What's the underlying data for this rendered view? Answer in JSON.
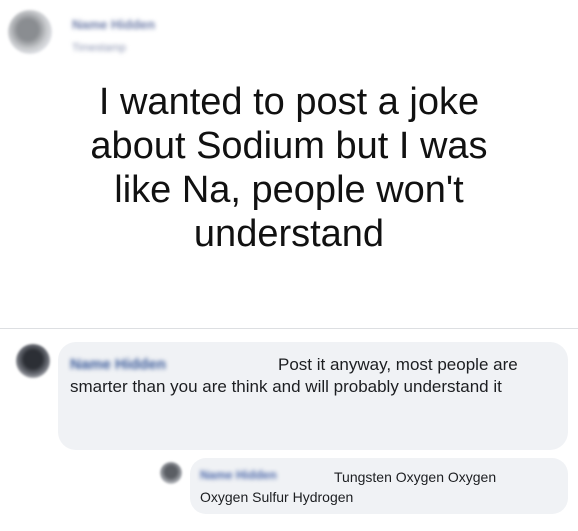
{
  "post": {
    "author": "Name Hidden",
    "timestamp": "Timestamp",
    "text": "I wanted to post a joke\nabout Sodium but I was\nlike Na, people won't\nunderstand"
  },
  "comment": {
    "author": "Name Hidden",
    "text": "Post it anyway, most people are smarter than you are think and will probably understand it"
  },
  "reply": {
    "author": "Name Hidden",
    "text": "Tungsten Oxygen Oxygen Oxygen Sulfur Hydrogen"
  },
  "colors": {
    "link_blue": "#385898",
    "bubble_bg": "#f0f2f5",
    "text": "#1c1e21"
  }
}
